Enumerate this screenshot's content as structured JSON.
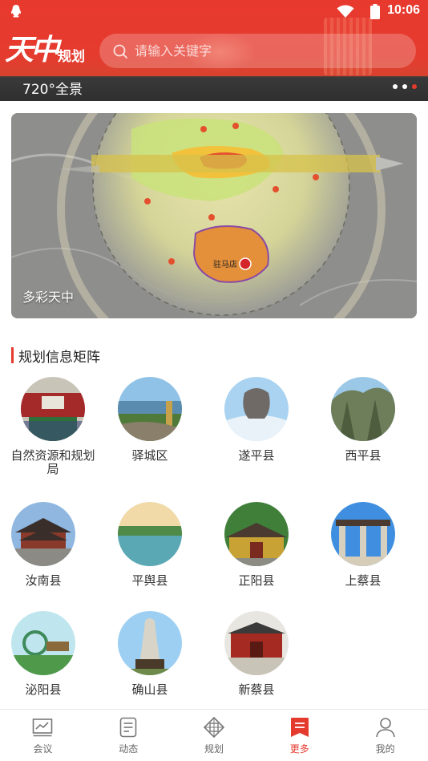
{
  "status_bar": {
    "time": "10:06",
    "left_icon": "qq-penguin-icon",
    "wifi_icon": "wifi-icon",
    "battery_icon": "battery-icon"
  },
  "header": {
    "logo_main": "天中",
    "logo_sub": "规划",
    "search_placeholder": "请输入关键字",
    "panorama_label": "720°全景",
    "carousel": {
      "count": 3,
      "active_index": 2
    },
    "accent_color": "#e53b2f"
  },
  "banner": {
    "caption": "多彩天中",
    "map_labels": {
      "center_city": "驻马店"
    }
  },
  "section": {
    "title": "规划信息矩阵",
    "items": [
      {
        "name": "自然资源和规划局",
        "icon": "meeting-hall-photo"
      },
      {
        "name": "驿城区",
        "icon": "lake-park-photo"
      },
      {
        "name": "遂平县",
        "icon": "rock-mountain-photo"
      },
      {
        "name": "西平县",
        "icon": "cliff-mountain-photo"
      },
      {
        "name": "汝南县",
        "icon": "ancient-building-photo"
      },
      {
        "name": "平舆县",
        "icon": "lake-sunset-photo"
      },
      {
        "name": "正阳县",
        "icon": "temple-photo"
      },
      {
        "name": "上蔡县",
        "icon": "memorial-arch-photo"
      },
      {
        "name": "泌阳县",
        "icon": "monument-square-photo"
      },
      {
        "name": "确山县",
        "icon": "statue-photo"
      },
      {
        "name": "新蔡县",
        "icon": "red-gate-photo"
      }
    ]
  },
  "bottom_nav": {
    "items": [
      {
        "label": "会议",
        "icon": "chart-monitor-icon"
      },
      {
        "label": "动态",
        "icon": "document-icon"
      },
      {
        "label": "规划",
        "icon": "diamond-grid-icon"
      },
      {
        "label": "更多",
        "icon": "bookmark-icon",
        "active": true
      },
      {
        "label": "我的",
        "icon": "user-icon"
      }
    ]
  }
}
